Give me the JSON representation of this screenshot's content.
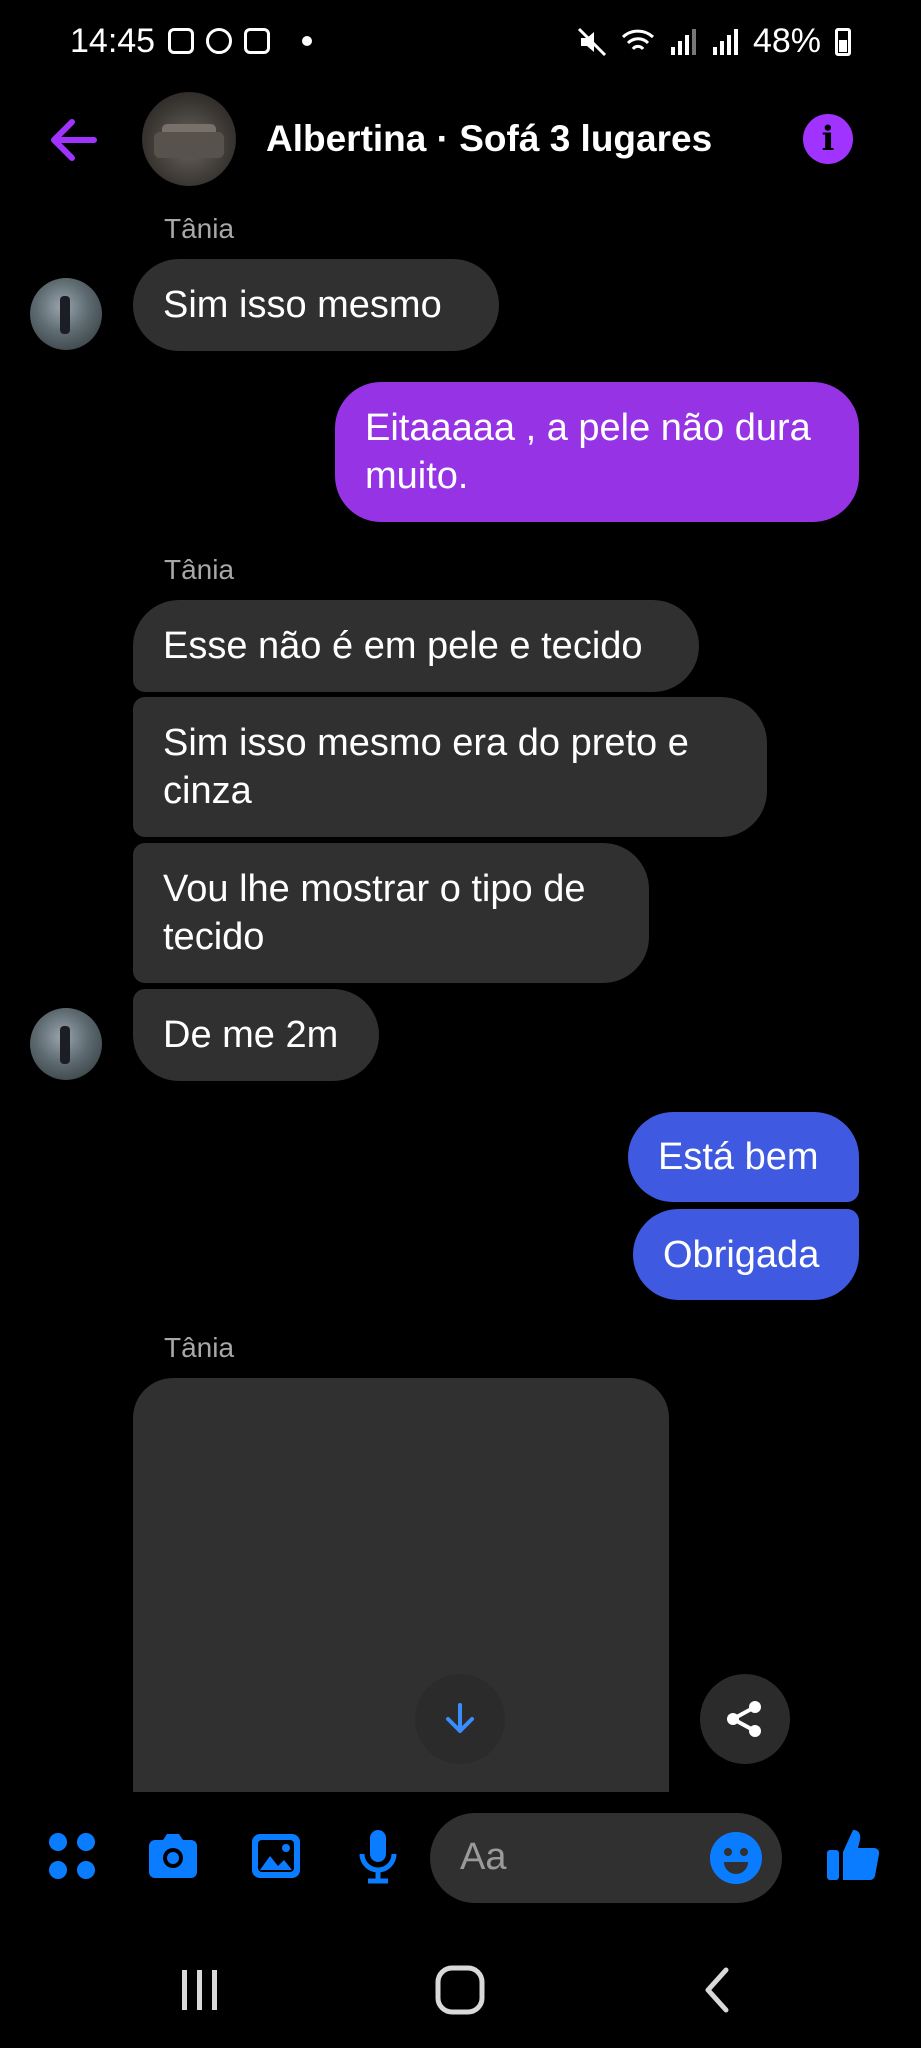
{
  "status_bar": {
    "time": "14:45",
    "battery": "48%"
  },
  "header": {
    "title": "Albertina · Sofá 3 lugares"
  },
  "messages": [
    {
      "sender": "Tânia"
    },
    {
      "text": "Sim isso mesmo"
    },
    {
      "text": "Eitaaaaa , a pele não dura muito."
    },
    {
      "sender": "Tânia"
    },
    {
      "text": "Esse não é em pele e tecido"
    },
    {
      "text": "Sim isso mesmo era do preto e cinza"
    },
    {
      "text": "Vou lhe mostrar o tipo de tecido"
    },
    {
      "text": "De me 2m"
    },
    {
      "text": "Está bem"
    },
    {
      "text": "Obrigada"
    },
    {
      "sender": "Tânia"
    }
  ],
  "composer": {
    "placeholder": "Aa"
  },
  "colors": {
    "accent_purple": "#9633e4",
    "accent_blue": "#3f5ae0",
    "incoming_bubble": "#303030",
    "icon_blue": "#0a7cff"
  },
  "icons": [
    "back-arrow-icon",
    "info-icon",
    "apps-icon",
    "camera-icon",
    "gallery-icon",
    "microphone-icon",
    "emoji-icon",
    "like-icon",
    "download-icon",
    "share-icon",
    "recents-icon",
    "home-icon",
    "nav-back-icon"
  ]
}
